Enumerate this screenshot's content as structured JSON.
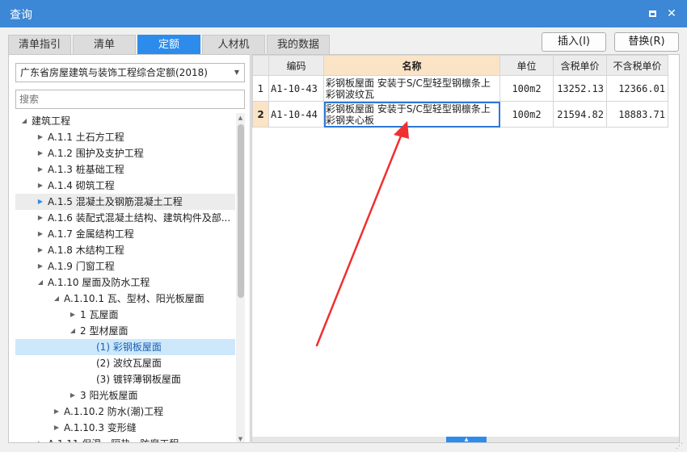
{
  "window": {
    "title": "查询"
  },
  "tabs": [
    {
      "label": "清单指引",
      "active": false
    },
    {
      "label": "清单",
      "active": false
    },
    {
      "label": "定额",
      "active": true
    },
    {
      "label": "人材机",
      "active": false
    },
    {
      "label": "我的数据",
      "active": false
    }
  ],
  "actions": {
    "insert_label": "插入(I)",
    "replace_label": "替换(R)"
  },
  "left": {
    "quota_library": "广东省房屋建筑与装饰工程综合定额(2018)",
    "search_placeholder": "搜索",
    "tree": [
      {
        "label": "建筑工程",
        "level": 0,
        "state": "expanded"
      },
      {
        "label": "A.1.1 土石方工程",
        "level": 1,
        "state": "collapsed"
      },
      {
        "label": "A.1.2 围护及支护工程",
        "level": 1,
        "state": "collapsed"
      },
      {
        "label": "A.1.3 桩基础工程",
        "level": 1,
        "state": "collapsed"
      },
      {
        "label": "A.1.4 砌筑工程",
        "level": 1,
        "state": "collapsed"
      },
      {
        "label": "A.1.5 混凝土及钢筋混凝土工程",
        "level": 1,
        "state": "collapsed",
        "highlight": "light"
      },
      {
        "label": "A.1.6 装配式混凝土结构、建筑构件及部...",
        "level": 1,
        "state": "collapsed"
      },
      {
        "label": "A.1.7 金属结构工程",
        "level": 1,
        "state": "collapsed"
      },
      {
        "label": "A.1.8 木结构工程",
        "level": 1,
        "state": "collapsed"
      },
      {
        "label": "A.1.9 门窗工程",
        "level": 1,
        "state": "collapsed"
      },
      {
        "label": "A.1.10 屋面及防水工程",
        "level": 1,
        "state": "expanded"
      },
      {
        "label": "A.1.10.1 瓦、型材、阳光板屋面",
        "level": 2,
        "state": "expanded"
      },
      {
        "label": "1 瓦屋面",
        "level": 3,
        "state": "collapsed"
      },
      {
        "label": "2 型材屋面",
        "level": 3,
        "state": "expanded"
      },
      {
        "label": "(1) 彩钢板屋面",
        "level": 4,
        "state": "leaf",
        "highlight": "blue"
      },
      {
        "label": "(2) 波纹瓦屋面",
        "level": 4,
        "state": "leaf"
      },
      {
        "label": "(3) 镀锌薄钢板屋面",
        "level": 4,
        "state": "leaf"
      },
      {
        "label": "3 阳光板屋面",
        "level": 3,
        "state": "collapsed"
      },
      {
        "label": "A.1.10.2 防水(潮)工程",
        "level": 2,
        "state": "collapsed"
      },
      {
        "label": "A.1.10.3 变形缝",
        "level": 2,
        "state": "collapsed"
      },
      {
        "label": "A.1.11 保温、隔热、防腐工程",
        "level": 1,
        "state": "collapsed"
      }
    ]
  },
  "grid": {
    "columns": [
      "",
      "编码",
      "名称",
      "单位",
      "含税单价",
      "不含税单价"
    ],
    "rows": [
      {
        "index": "1",
        "code": "A1-10-43",
        "name_line1": "彩钢板屋面 安装于S/C型轻型钢檩条上",
        "name_line2": "彩钢波纹瓦",
        "unit": "100m2",
        "price_tax": "13252.13",
        "price_notax": "12366.01",
        "current": false
      },
      {
        "index": "2",
        "code": "A1-10-44",
        "name_line1": "彩钢板屋面 安装于S/C型轻型钢檩条上",
        "name_line2": "彩钢夹心板",
        "unit": "100m2",
        "price_tax": "21594.82",
        "price_notax": "18883.71",
        "current": true
      }
    ]
  },
  "colors": {
    "titlebar": "#3c87d6",
    "tab_active": "#2d8ceb",
    "header_highlight": "#fbe3c5",
    "tree_selection": "#cde8fb",
    "annotation_arrow": "#f03030"
  },
  "icons": {
    "maximize": "maximize-icon",
    "close": "close-icon",
    "expand": "triangle-right-icon",
    "collapse": "triangle-down-icon"
  }
}
